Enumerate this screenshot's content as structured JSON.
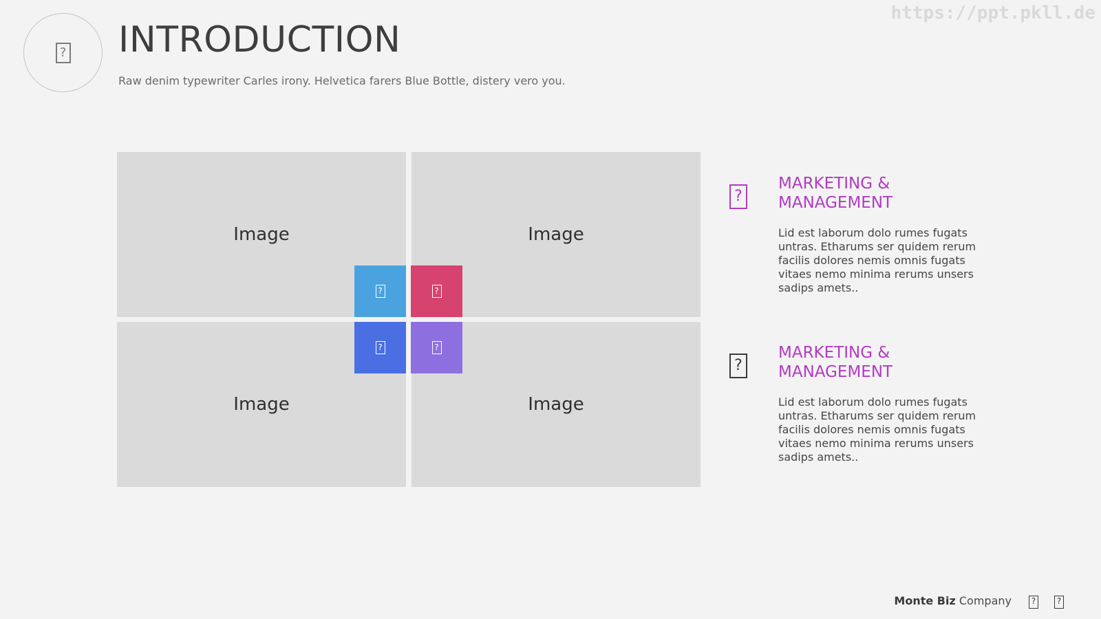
{
  "watermark": "https://ppt.pkll.de",
  "header": {
    "icon": "missing-glyph-icon",
    "title": "INTRODUCTION",
    "subtitle": "Raw denim typewriter Carles irony. Helvetica farers Blue Bottle, distery vero you."
  },
  "images": {
    "top_left": "Image",
    "top_right": "Image",
    "bottom_left": "Image",
    "bottom_right": "Image"
  },
  "tiles": [
    {
      "icon": "missing-glyph-icon",
      "glyph": "?",
      "color": "#4aa3df"
    },
    {
      "icon": "missing-glyph-icon",
      "glyph": "?",
      "color": "#d6436e"
    },
    {
      "icon": "missing-glyph-icon",
      "glyph": "?",
      "color": "#4a6fe3"
    },
    {
      "icon": "missing-glyph-icon",
      "glyph": "?",
      "color": "#8e6fe0"
    }
  ],
  "features": [
    {
      "icon": "missing-glyph-icon",
      "icon_color": "#b13bc1",
      "title": "MARKETING & MANAGEMENT",
      "body": "Lid est laborum dolo rumes fugats untras. Etharums ser quidem rerum facilis dolores nemis omnis fugats vitaes nemo minima rerums unsers sadips amets.."
    },
    {
      "icon": "missing-glyph-icon",
      "icon_color": "#3a3a3a",
      "title": "MARKETING & MANAGEMENT",
      "body": "Lid est laborum dolo rumes fugats untras. Etharums ser quidem rerum facilis dolores nemis omnis fugats vitaes nemo minima rerums unsers sadips amets.."
    }
  ],
  "footer": {
    "brand": "Monte Biz",
    "suffix": "Company",
    "icons": [
      "missing-glyph-icon",
      "missing-glyph-icon"
    ],
    "glyph": "?"
  },
  "colors": {
    "background": "#f3f3f3",
    "accent": "#b13bc1",
    "placeholder": "#dadada"
  }
}
